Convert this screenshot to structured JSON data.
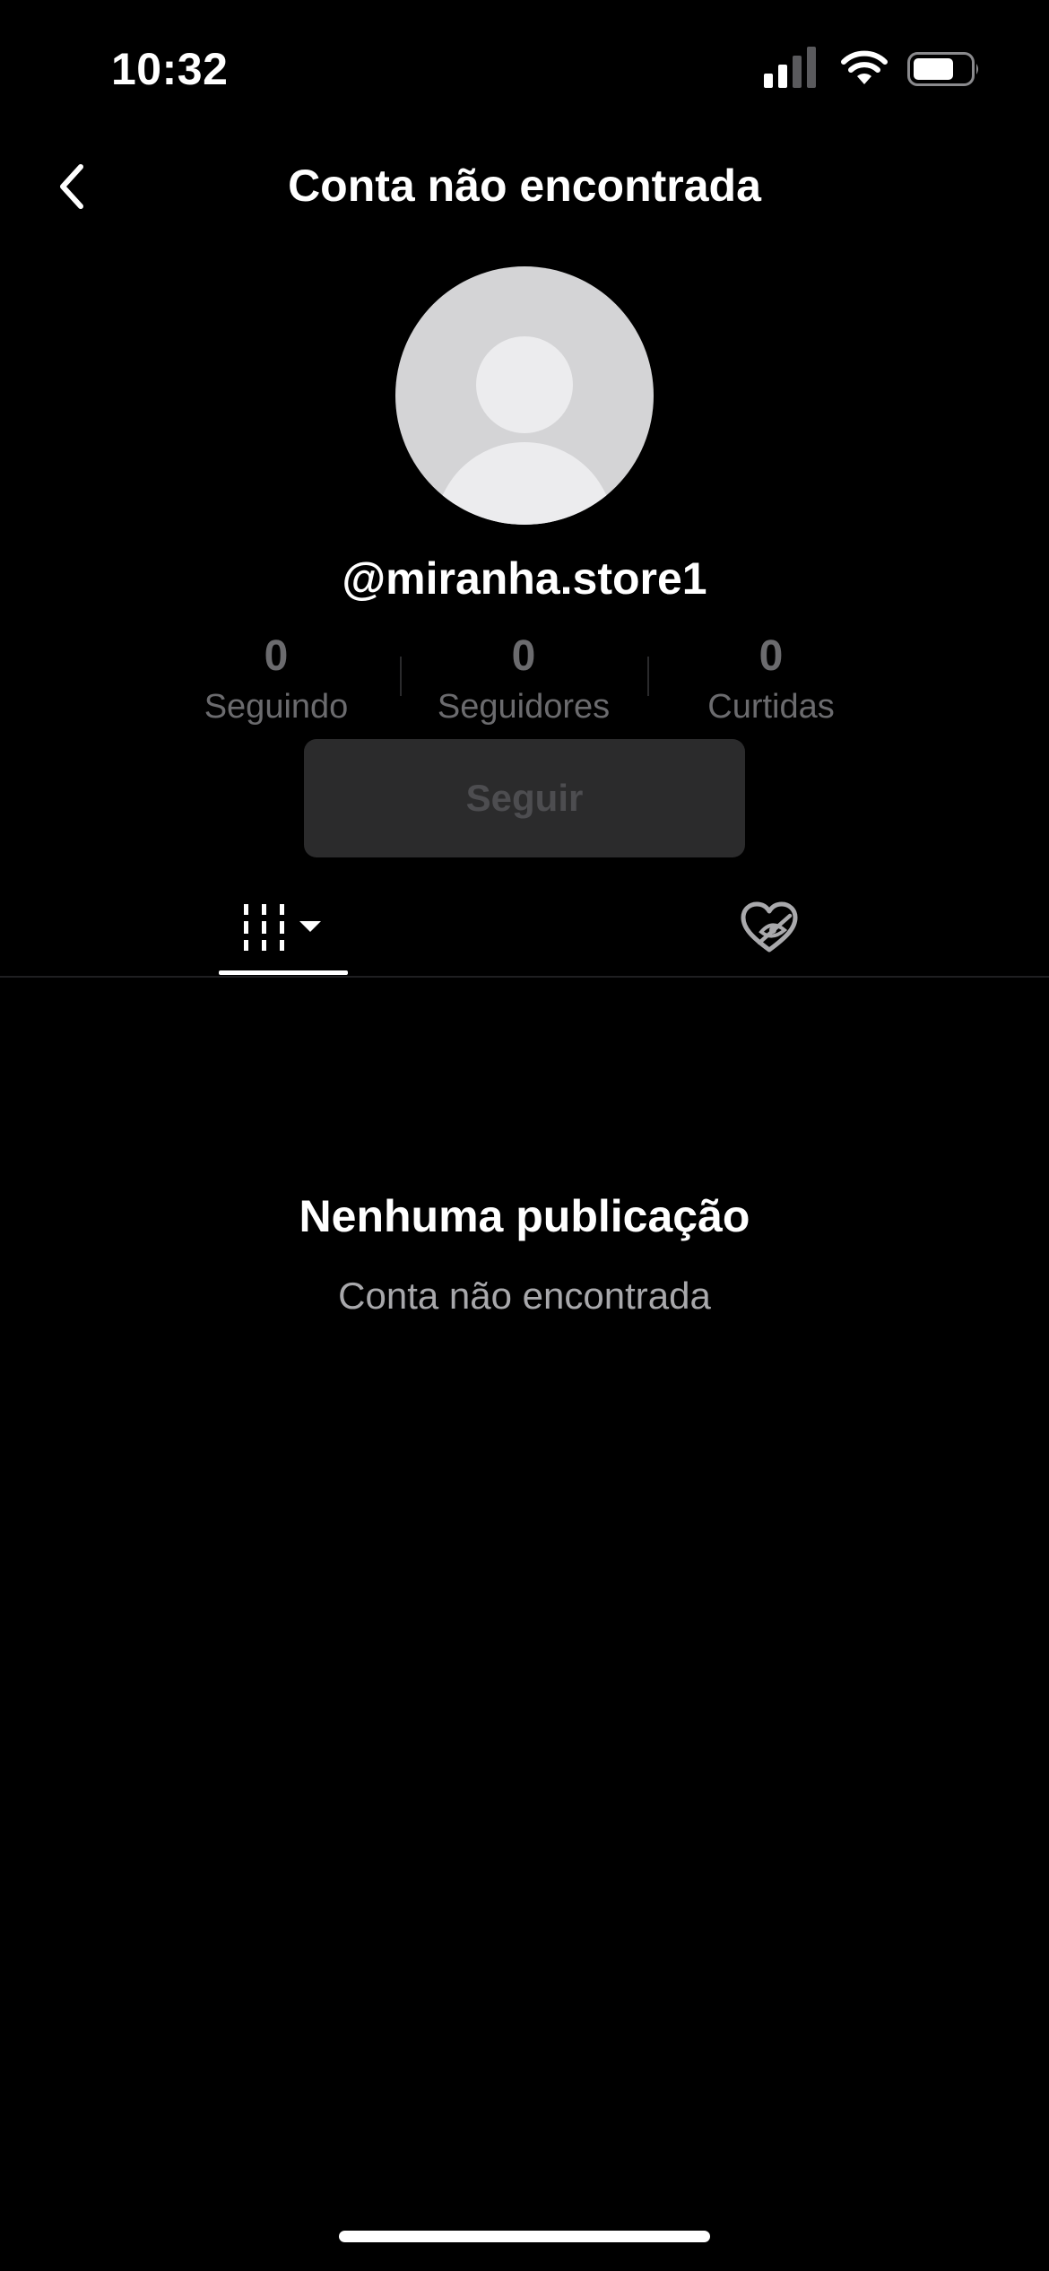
{
  "status_bar": {
    "time": "10:32",
    "icons": [
      "signal-icon",
      "wifi-icon",
      "battery-icon"
    ]
  },
  "header": {
    "title": "Conta não encontrada",
    "back_icon": "chevron-left-icon"
  },
  "profile": {
    "avatar_icon": "default-avatar-icon",
    "username": "@miranha.store1",
    "stats": [
      {
        "value": "0",
        "label": "Seguindo"
      },
      {
        "value": "0",
        "label": "Seguidores"
      },
      {
        "value": "0",
        "label": "Curtidas"
      }
    ],
    "follow_label": "Seguir"
  },
  "tabs": [
    {
      "icon": "videos-grid-icon",
      "selected": true
    },
    {
      "icon": "liked-hidden-icon",
      "selected": false
    }
  ],
  "empty_state": {
    "title": "Nenhuma publicação",
    "subtitle": "Conta não encontrada"
  },
  "colors": {
    "background": "#000000",
    "text": "#ffffff",
    "muted": "#6b6b6e",
    "button_bg": "#2b2b2c",
    "avatar_bg": "#d4d4d6"
  }
}
